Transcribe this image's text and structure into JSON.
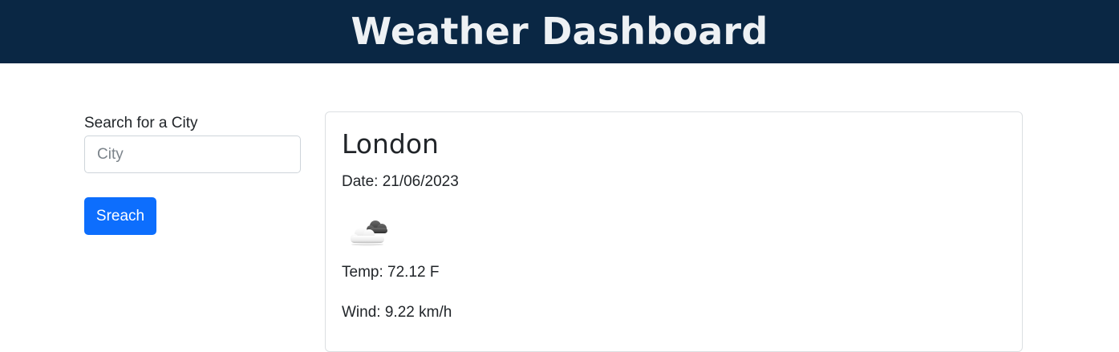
{
  "header": {
    "title": "Weather Dashboard"
  },
  "search": {
    "label": "Search for a City",
    "placeholder": "City",
    "value": "",
    "button_label": "Sreach"
  },
  "current_weather": {
    "city": "London",
    "date_label": "Date:",
    "date": "21/06/2023",
    "icon": "partly-cloudy-icon",
    "temp_label": "Temp:",
    "temp": "72.12 F",
    "wind_label": "Wind:",
    "wind": "9.22 km/h"
  },
  "colors": {
    "header_bg": "#0a2744",
    "header_text": "#eef1f4",
    "button_bg": "#0d6efd",
    "button_text": "#ffffff"
  }
}
